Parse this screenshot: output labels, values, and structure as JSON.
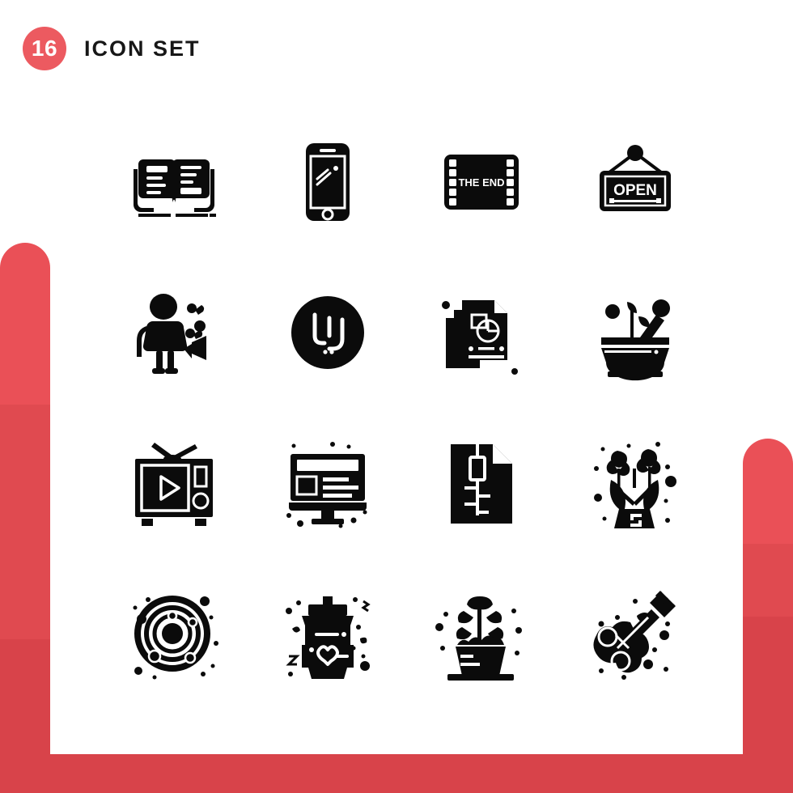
{
  "header": {
    "count": "16",
    "title": "Icon Set"
  },
  "theme": {
    "accent": "#ec5a60",
    "accent_mid": "#e04a50",
    "accent_dark": "#d8434a",
    "icon_color": "#0b0b0b",
    "background": "#ffffff",
    "title_color": "#171717"
  },
  "grid": {
    "columns": 4,
    "rows": 4,
    "total": 16
  },
  "icons": [
    {
      "id": "open-book",
      "name": "Open Book",
      "row": 1,
      "col": 1,
      "label": ""
    },
    {
      "id": "smartphone",
      "name": "Smartphone",
      "row": 1,
      "col": 2,
      "label": ""
    },
    {
      "id": "film-the-end",
      "name": "Film The End",
      "row": 1,
      "col": 3,
      "label": "THE END"
    },
    {
      "id": "open-sign",
      "name": "Open Sign",
      "row": 1,
      "col": 4,
      "label": "OPEN"
    },
    {
      "id": "party-blower",
      "name": "Party Person",
      "row": 2,
      "col": 1,
      "label": ""
    },
    {
      "id": "riyal-coin",
      "name": "Riyal Coin",
      "row": 2,
      "col": 2,
      "label": "ريال"
    },
    {
      "id": "documents",
      "name": "Report Documents",
      "row": 2,
      "col": 3,
      "label": ""
    },
    {
      "id": "mortar-pestle",
      "name": "Mortar And Pestle",
      "row": 2,
      "col": 4,
      "label": ""
    },
    {
      "id": "retro-tv",
      "name": "Retro Television",
      "row": 3,
      "col": 1,
      "label": ""
    },
    {
      "id": "monitor",
      "name": "Desktop Monitor",
      "row": 3,
      "col": 2,
      "label": ""
    },
    {
      "id": "zip-file",
      "name": "Zip File",
      "row": 3,
      "col": 3,
      "label": ""
    },
    {
      "id": "flower-vase",
      "name": "Flower Bouquet",
      "row": 3,
      "col": 4,
      "label": ""
    },
    {
      "id": "solar-system",
      "name": "Solar System",
      "row": 4,
      "col": 1,
      "label": ""
    },
    {
      "id": "coffee-cup",
      "name": "Coffee Cup Heart",
      "row": 4,
      "col": 2,
      "label": ""
    },
    {
      "id": "potted-plant",
      "name": "Potted Plant",
      "row": 4,
      "col": 3,
      "label": ""
    },
    {
      "id": "guitar",
      "name": "Electric Guitar",
      "row": 4,
      "col": 4,
      "label": ""
    }
  ]
}
